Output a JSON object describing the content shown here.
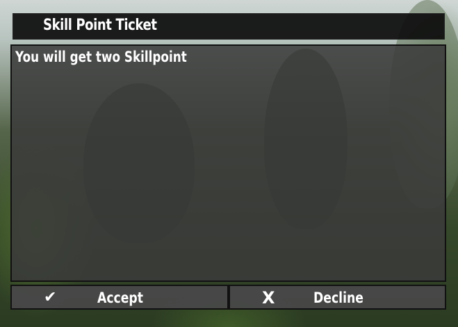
{
  "dialog": {
    "title": "Skill Point Ticket",
    "message": "You will get two Skillpoint"
  },
  "buttons": {
    "accept": {
      "label": "Accept",
      "icon": "✔",
      "icon_name": "checkmark-icon"
    },
    "decline": {
      "label": "Decline",
      "icon": "X",
      "icon_name": "x-icon"
    }
  }
}
